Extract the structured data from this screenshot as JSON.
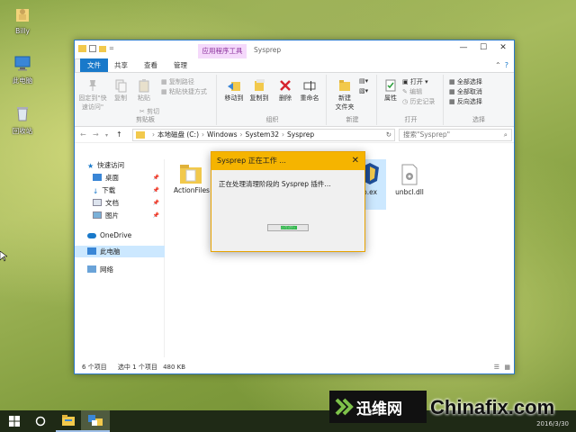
{
  "desktop": {
    "icons": [
      {
        "label": "Billy",
        "icon": "user-folder-icon"
      },
      {
        "label": "此电脑",
        "icon": "computer-icon"
      },
      {
        "label": "回收站",
        "icon": "recycle-bin-icon"
      }
    ]
  },
  "explorer": {
    "context_tab": "应用程序工具",
    "title": "Sysprep",
    "tabs": [
      "文件",
      "主页",
      "共享",
      "查看",
      "管理"
    ],
    "active_tab": "主页",
    "ribbon": {
      "clipboard": {
        "pin": "固定到\"快\n速访问\"",
        "copy": "复制",
        "paste": "粘贴",
        "copy_path": "复制路径",
        "paste_shortcut": "粘贴快捷方式",
        "cut": "剪切",
        "label": "剪贴板"
      },
      "organize": {
        "move_to": "移动到",
        "copy_to": "复制到",
        "delete": "删除",
        "rename": "重命名",
        "label": "组织"
      },
      "new": {
        "new_folder": "新建\n文件夹",
        "label": "新建"
      },
      "open": {
        "properties": "属性",
        "open": "打开",
        "edit": "编辑",
        "history": "历史记录",
        "label": "打开"
      },
      "select": {
        "select_all": "全部选择",
        "select_none": "全部取消",
        "invert": "反向选择",
        "label": "选择"
      }
    },
    "address": {
      "crumbs": [
        "本地磁盘 (C:)",
        "Windows",
        "System32",
        "Sysprep"
      ],
      "search_placeholder": "搜索\"Sysprep\""
    },
    "nav": [
      {
        "label": "快速访问",
        "icon": "star-icon",
        "pinned": false
      },
      {
        "label": "桌面",
        "icon": "desktop-icon",
        "pinned": true
      },
      {
        "label": "下载",
        "icon": "download-icon",
        "pinned": true
      },
      {
        "label": "文档",
        "icon": "document-icon",
        "pinned": true
      },
      {
        "label": "图片",
        "icon": "picture-icon",
        "pinned": true
      },
      {
        "label": "OneDrive",
        "icon": "cloud-icon",
        "pinned": false
      },
      {
        "label": "此电脑",
        "icon": "computer-icon",
        "pinned": false
      },
      {
        "label": "网络",
        "icon": "network-icon",
        "pinned": false
      }
    ],
    "files": [
      {
        "name": "ActionFiles",
        "icon": "folder-icon"
      },
      {
        "name": "p.ex",
        "icon": "exe-icon"
      },
      {
        "name": "unbcl.dll",
        "icon": "dll-icon"
      }
    ],
    "status": {
      "count": "6 个项目",
      "selected": "选中 1 个项目",
      "size": "480 KB"
    }
  },
  "dialog": {
    "title": "Sysprep 正在工作 ...",
    "message": "正在处理清理阶段的 Sysprep 插件...",
    "progress_label": "正在进行"
  },
  "taskbar": {
    "items": [
      "windows-start-icon",
      "cortana-circle-icon",
      "file-explorer-icon",
      "sysprep-app-icon"
    ]
  },
  "watermark": {
    "cn": "迅维网",
    "en": "Chinafix.com",
    "date": "2016/3/30"
  }
}
